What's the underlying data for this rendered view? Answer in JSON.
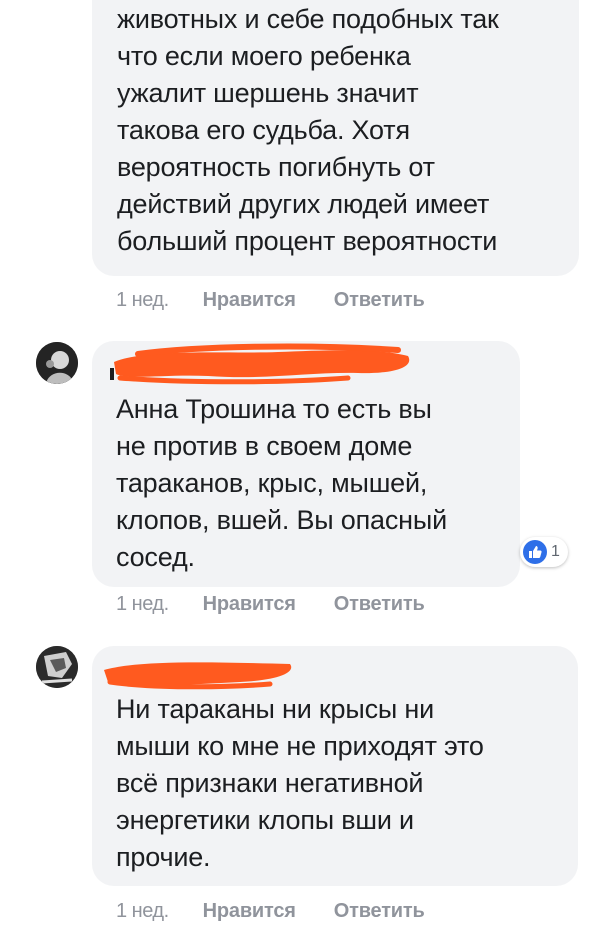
{
  "comments": [
    {
      "text": "животных и себе подобных так\nчто если моего ребенка\nужалит шершень значит\nтакова его судьба. Хотя\nвероятность погибнуть от\nдействий других людей имеет\nбольший процент вероятности",
      "time": "1 нед.",
      "like_label": "Нравится",
      "reply_label": "Ответить"
    },
    {
      "text": "Анна Трошина то есть вы\nне против в своем доме\nтараканов, крыс, мышей,\nклопов, вшей. Вы опасный\nсосед.",
      "time": "1 нед.",
      "like_label": "Нравится",
      "reply_label": "Ответить",
      "reaction_count": "1"
    },
    {
      "text": "Ни тараканы ни крысы ни\nмыши ко мне не приходят это\nвсё признаки негативной\nэнергетики клопы вши и\nпрочие.",
      "time": "1 нед.",
      "like_label": "Нравится",
      "reply_label": "Ответить"
    }
  ],
  "colors": {
    "bubble": "#f2f3f5",
    "meta_text": "#90949c",
    "redaction": "#ff5a1f",
    "like_blue": "#2e6fe8"
  },
  "icons": {
    "like": "thumbs-up-icon"
  }
}
